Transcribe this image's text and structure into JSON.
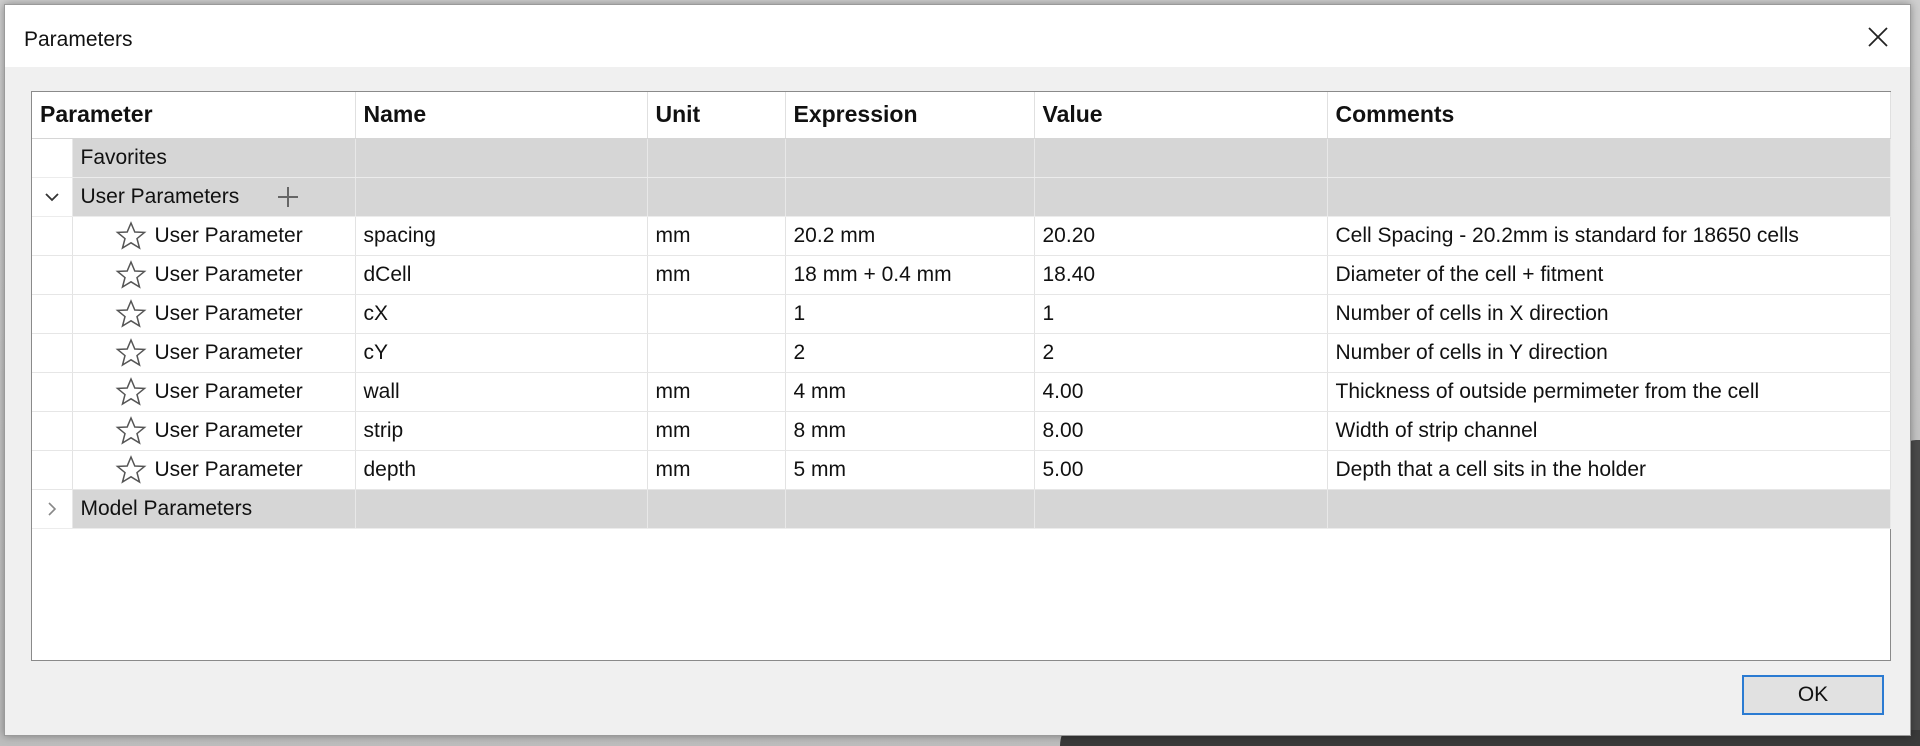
{
  "dialog": {
    "title": "Parameters",
    "ok_label": "OK"
  },
  "table": {
    "columns": [
      "Parameter",
      "Name",
      "Unit",
      "Expression",
      "Value",
      "Comments"
    ],
    "groups": {
      "favorites": "Favorites",
      "user": "User Parameters",
      "model": "Model Parameters"
    },
    "rows": [
      {
        "type": "User Parameter",
        "name": "spacing",
        "unit": "mm",
        "expression": "20.2 mm",
        "value": "20.20",
        "comment": "Cell Spacing - 20.2mm is standard for 18650 cells"
      },
      {
        "type": "User Parameter",
        "name": "dCell",
        "unit": "mm",
        "expression": "18 mm + 0.4 mm",
        "value": "18.40",
        "comment": "Diameter of the cell + fitment"
      },
      {
        "type": "User Parameter",
        "name": "cX",
        "unit": "",
        "expression": "1",
        "value": "1",
        "comment": "Number of cells in X direction"
      },
      {
        "type": "User Parameter",
        "name": "cY",
        "unit": "",
        "expression": "2",
        "value": "2",
        "comment": "Number of cells in Y direction"
      },
      {
        "type": "User Parameter",
        "name": "wall",
        "unit": "mm",
        "expression": "4 mm",
        "value": "4.00",
        "comment": "Thickness of outside permimeter from the cell"
      },
      {
        "type": "User Parameter",
        "name": "strip",
        "unit": "mm",
        "expression": "8 mm",
        "value": "8.00",
        "comment": "Width of strip channel"
      },
      {
        "type": "User Parameter",
        "name": "depth",
        "unit": "mm",
        "expression": "5 mm",
        "value": "5.00",
        "comment": "Depth that a cell sits in the holder"
      }
    ]
  },
  "icons": {
    "close": "close-icon",
    "star": "star-icon",
    "add": "plus-icon",
    "expand": "chevron-down-icon",
    "collapse": "chevron-right-icon"
  },
  "colors": {
    "group_row": "#d6d6d6",
    "ok_border": "#2b7bd2"
  }
}
